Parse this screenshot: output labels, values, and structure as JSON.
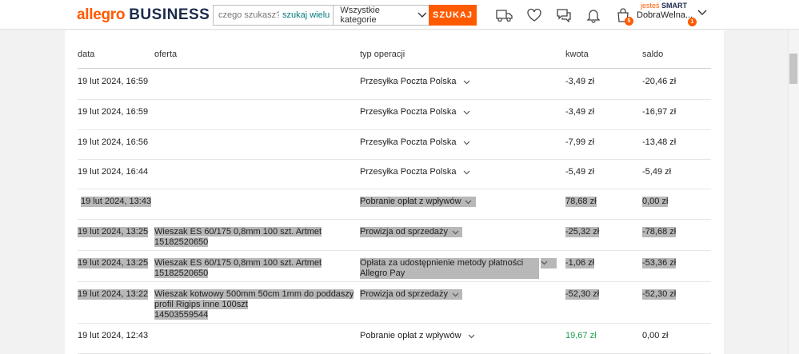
{
  "header": {
    "logo_part1": "allegro",
    "logo_part2": "BUSINESS",
    "search_placeholder": "czego szukasz?",
    "search_wide": "szukaj wielu",
    "category": "Wszystkie kategorie",
    "search_button": "SZUKAJ",
    "cart_count": "5",
    "smart_prefix": "jesteś",
    "smart_word": "SMART",
    "user_name": "DobraWelna...",
    "user_badge": "1"
  },
  "table": {
    "headers": {
      "date": "data",
      "offer": "oferta",
      "type": "typ operacji",
      "amount": "kwota",
      "balance": "saldo"
    },
    "rows": [
      {
        "date": "19 lut 2024, 16:59",
        "offer": "",
        "offer_id": "",
        "type": "Przesyłka Poczta Polska",
        "amount": "-3,49 zł",
        "balance": "-20,46 zł"
      },
      {
        "date": "19 lut 2024, 16:59",
        "offer": "",
        "offer_id": "",
        "type": "Przesyłka Poczta Polska",
        "amount": "-3,49 zł",
        "balance": "-16,97 zł"
      },
      {
        "date": "19 lut 2024, 16:56",
        "offer": "",
        "offer_id": "",
        "type": "Przesyłka Poczta Polska",
        "amount": "-7,99 zł",
        "balance": "-13,48 zł"
      },
      {
        "date": "19 lut 2024, 16:44",
        "offer": "",
        "offer_id": "",
        "type": "Przesyłka Poczta Polska",
        "amount": "-5,49 zł",
        "balance": "-5,49 zł"
      },
      {
        "date": "19 lut 2024, 13:43",
        "offer": "",
        "offer_id": "",
        "type": "Pobranie opłat z wpływów",
        "amount": "78,68 zł",
        "balance": "0,00 zł"
      },
      {
        "date": "19 lut 2024, 13:25",
        "offer": "Wieszak ES 60/175 0,8mm 100 szt. Artmet",
        "offer_id": "15182520650",
        "type": "Prowizja od sprzedaży",
        "amount": "-25,32 zł",
        "balance": "-78,68 zł"
      },
      {
        "date": "19 lut 2024, 13:25",
        "offer": "Wieszak ES 60/175 0,8mm 100 szt. Artmet",
        "offer_id": "15182520650",
        "type": "Opłata za udostępnienie metody płatności Allegro Pay",
        "amount": "-1,06 zł",
        "balance": "-53,36 zł"
      },
      {
        "date": "19 lut 2024, 13:22",
        "offer": "Wieszak kotwowy 500mm 50cm 1mm do poddaszy profil Rigips inne 100szt",
        "offer_id": "14503559544",
        "type": "Prowizja od sprzedaży",
        "amount": "-52,30 zł",
        "balance": "-52,30 zł"
      },
      {
        "date": "19 lut 2024, 12:43",
        "offer": "",
        "offer_id": "",
        "type": "Pobranie opłat z wpływów",
        "amount": "19,67 zł",
        "balance": "0,00 zł"
      }
    ]
  },
  "colors": {
    "brand": "#ff5a00",
    "teal": "#00797a",
    "positive": "#1e9c4c",
    "highlight": "#b8b8b8"
  }
}
